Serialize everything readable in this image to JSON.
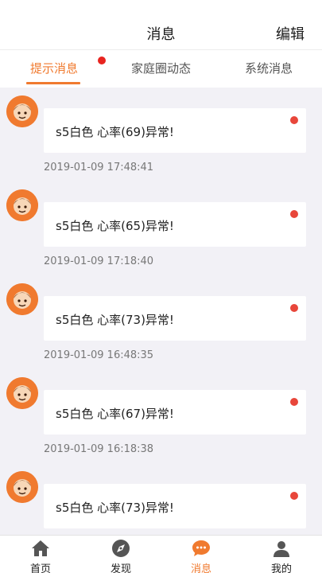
{
  "header": {
    "title": "消息",
    "edit_label": "编辑"
  },
  "tabs": [
    {
      "label": "提示消息",
      "active": true,
      "has_badge": true
    },
    {
      "label": "家庭圈动态",
      "active": false
    },
    {
      "label": "系统消息",
      "active": false
    }
  ],
  "messages": [
    {
      "text": "s5白色 心率(69)异常!",
      "time": "2019-01-09 17:48:41",
      "unread": true
    },
    {
      "text": "s5白色 心率(65)异常!",
      "time": "2019-01-09 17:18:40",
      "unread": true
    },
    {
      "text": "s5白色 心率(73)异常!",
      "time": "2019-01-09 16:48:35",
      "unread": true
    },
    {
      "text": "s5白色 心率(67)异常!",
      "time": "2019-01-09 16:18:38",
      "unread": true
    },
    {
      "text": "s5白色 心率(73)异常!",
      "time": "",
      "unread": true
    }
  ],
  "bottom_nav": [
    {
      "label": "首页",
      "icon": "home-icon",
      "active": false
    },
    {
      "label": "发现",
      "icon": "compass-icon",
      "active": false
    },
    {
      "label": "消息",
      "icon": "chat-icon",
      "active": true
    },
    {
      "label": "我的",
      "icon": "profile-icon",
      "active": false
    }
  ],
  "colors": {
    "accent": "#f07a2f",
    "badge": "#e8241f",
    "background": "#f2f1f6"
  }
}
